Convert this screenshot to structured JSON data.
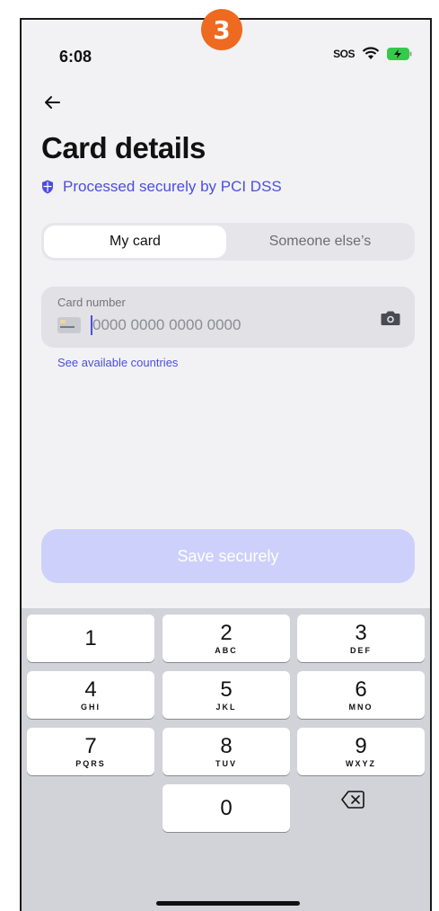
{
  "step_badge": "3",
  "status_bar": {
    "time": "6:08",
    "sos": "SOS"
  },
  "header": {
    "title": "Card details",
    "secure_text": "Processed securely by PCI DSS"
  },
  "card_owner_toggle": {
    "options": [
      "My card",
      "Someone else’s"
    ],
    "selected": "My card"
  },
  "card_number": {
    "label": "Card number",
    "placeholder": "0000 0000 0000 0000"
  },
  "countries_link": "See available countries",
  "save_button": "Save securely",
  "keypad": {
    "keys": [
      {
        "num": "1",
        "letters": ""
      },
      {
        "num": "2",
        "letters": "ABC"
      },
      {
        "num": "3",
        "letters": "DEF"
      },
      {
        "num": "4",
        "letters": "GHI"
      },
      {
        "num": "5",
        "letters": "JKL"
      },
      {
        "num": "6",
        "letters": "MNO"
      },
      {
        "num": "7",
        "letters": "PQRS"
      },
      {
        "num": "8",
        "letters": "TUV"
      },
      {
        "num": "9",
        "letters": "WXYZ"
      },
      {
        "num": "0",
        "letters": ""
      }
    ]
  },
  "colors": {
    "accent": "#4b4ee0",
    "badge": "#ee6a21",
    "save_disabled": "#cdd0fb"
  }
}
